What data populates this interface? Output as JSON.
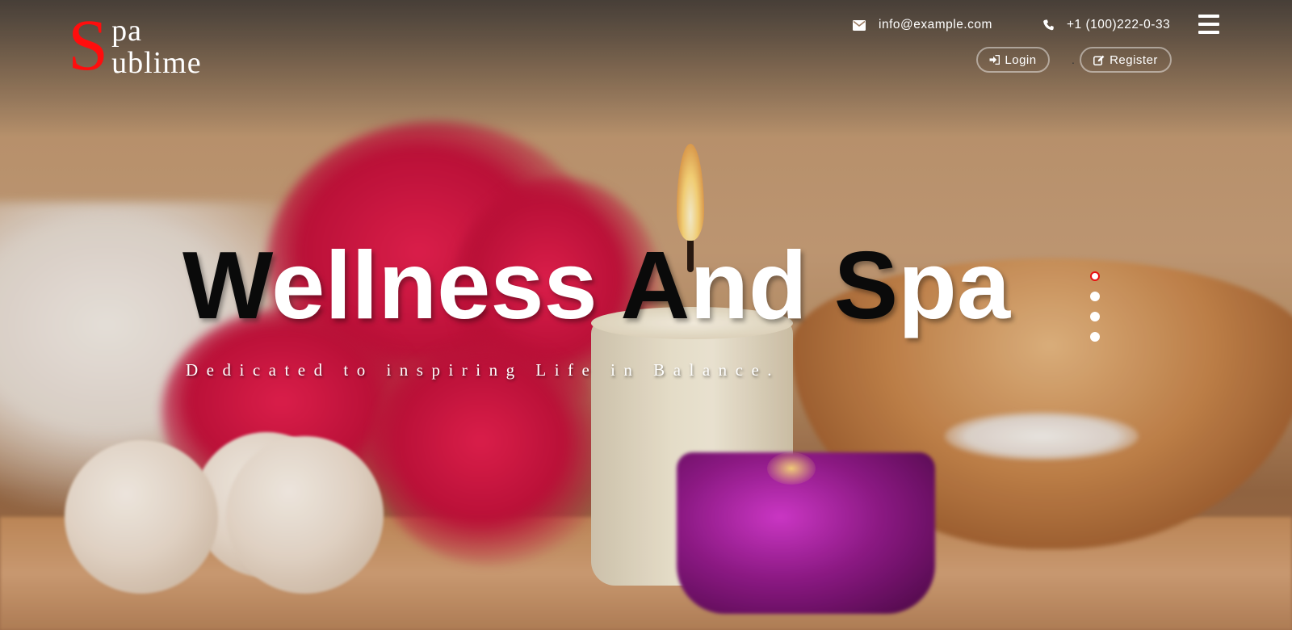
{
  "logo": {
    "initial": "S",
    "line1": "pa",
    "line2": "ublime",
    "initial_color": "#ff0d0d"
  },
  "header": {
    "email": "info@example.com",
    "email_icon": "envelope-icon",
    "phone": "+1 (100)222-0-33",
    "phone_icon": "phone-icon",
    "menu_icon": "hamburger-menu-icon",
    "login_label": "Login",
    "login_icon": "sign-in-icon",
    "register_label": "Register",
    "register_icon": "edit-icon",
    "separator": "."
  },
  "hero": {
    "title_parts": [
      {
        "text": "W",
        "tone": "dark"
      },
      {
        "text": "ellness ",
        "tone": "light"
      },
      {
        "text": "A",
        "tone": "dark"
      },
      {
        "text": "nd ",
        "tone": "light"
      },
      {
        "text": "S",
        "tone": "dark"
      },
      {
        "text": "pa",
        "tone": "light"
      }
    ],
    "tagline": "Dedicated to inspiring Life in Balance."
  },
  "slider": {
    "dot_count": 4,
    "active_index": 0,
    "active_color": "#e81010"
  }
}
